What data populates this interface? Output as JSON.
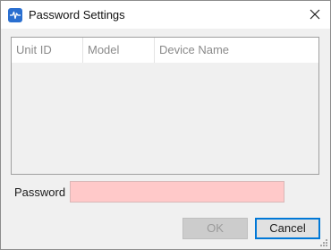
{
  "window": {
    "title": "Password Settings",
    "app_icon": "waveform-icon",
    "close_icon": "close-icon"
  },
  "device_list": {
    "columns": [
      "Unit ID",
      "Model",
      "Device Name"
    ],
    "rows": []
  },
  "password": {
    "label": "Password",
    "value": "",
    "field_color": "#ffc9c9"
  },
  "buttons": {
    "ok_label": "OK",
    "ok_enabled": false,
    "cancel_label": "Cancel"
  },
  "colors": {
    "accent": "#0078d7",
    "icon": "#2a6fd0"
  }
}
